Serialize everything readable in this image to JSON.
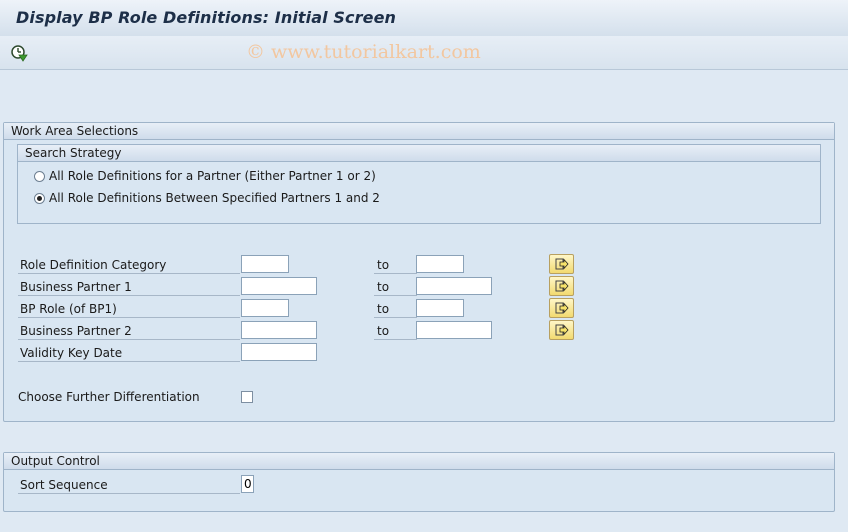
{
  "window": {
    "title": "Display BP Role Definitions: Initial Screen",
    "watermark": "© www.tutorialkart.com"
  },
  "toolbar": {
    "execute_icon": "execute-clock-icon"
  },
  "work_area": {
    "title": "Work Area Selections",
    "search_strategy": {
      "title": "Search Strategy",
      "options": [
        {
          "label": "All Role Definitions for a Partner (Either Partner 1 or 2)",
          "selected": false
        },
        {
          "label": "All Role Definitions Between Specified Partners 1 and 2",
          "selected": true
        }
      ]
    },
    "fields": [
      {
        "label": "Role Definition Category",
        "from": "",
        "to_label": "to",
        "to": "",
        "multi_icon": "arrow-right-icon"
      },
      {
        "label": "Business Partner 1",
        "from": "",
        "to_label": "to",
        "to": "",
        "multi_icon": "arrow-right-icon"
      },
      {
        "label": "BP Role (of BP1)",
        "from": "",
        "to_label": "to",
        "to": "",
        "multi_icon": "arrow-right-icon"
      },
      {
        "label": "Business Partner 2",
        "from": "",
        "to_label": "to",
        "to": "",
        "multi_icon": "arrow-right-icon"
      },
      {
        "label": "Validity Key Date",
        "from": ""
      }
    ],
    "further_diff": {
      "label": "Choose Further Differentiation",
      "checked": false
    }
  },
  "output_control": {
    "title": "Output Control",
    "sort_sequence": {
      "label": "Sort Sequence",
      "value": "0"
    }
  },
  "colors": {
    "background": "#dfe9f3",
    "title_text": "#1d2f48",
    "watermark": "#f2c7a0",
    "arrow_button": "#f2da70"
  }
}
